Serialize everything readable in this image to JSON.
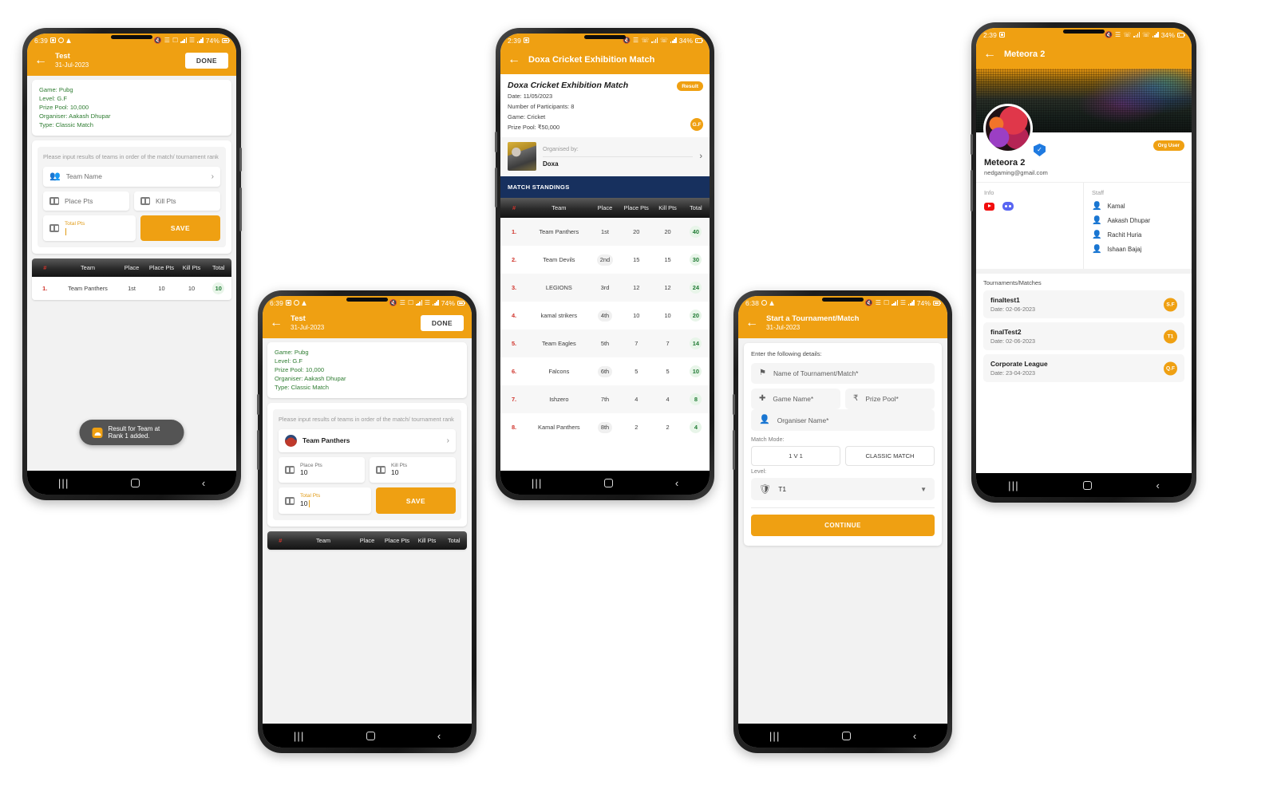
{
  "colors": {
    "accent": "#efa012",
    "green_text": "#2f7d32",
    "navy": "#17305e",
    "verify_blue": "#1f7ae0"
  },
  "phone1": {
    "status": {
      "time": "6:39",
      "battery": "74%"
    },
    "appbar": {
      "title": "Test",
      "subtitle": "31-Jul-2023",
      "done_label": "DONE"
    },
    "info": {
      "game": "Game: Pubg",
      "level": "Level: G.F",
      "prize": "Prize Pool: 10,000",
      "organiser": "Organiser: Aakash Dhupar",
      "type": "Type: Classic Match"
    },
    "hint": "Please input results of teams in order of the match/ tournament rank",
    "team_field_placeholder": "Team Name",
    "place_pts_placeholder": "Place Pts",
    "kill_pts_placeholder": "Kill Pts",
    "total_pts_label": "Total Pts",
    "total_pts_value": "",
    "save_label": "SAVE",
    "table": {
      "headers": [
        "#",
        "Team",
        "Place",
        "Place Pts",
        "Kill Pts",
        "Total"
      ],
      "rows": [
        {
          "num": "1.",
          "team": "Team Panthers",
          "place": "1st",
          "place_pts": "10",
          "kill_pts": "10",
          "total": "10"
        }
      ]
    },
    "toast": "Result for Team at Rank 1 added."
  },
  "phone2": {
    "status": {
      "time": "6:39",
      "battery": "74%"
    },
    "appbar": {
      "title": "Test",
      "subtitle": "31-Jul-2023",
      "done_label": "DONE"
    },
    "info": {
      "game": "Game: Pubg",
      "level": "Level: G.F",
      "prize": "Prize Pool: 10,000",
      "organiser": "Organiser: Aakash Dhupar",
      "type": "Type: Classic Match"
    },
    "hint": "Please input results of teams in order of the match/ tournament rank",
    "selected_team": "Team Panthers",
    "place_pts_label": "Place Pts",
    "place_pts_value": "10",
    "kill_pts_label": "Kill Pts",
    "kill_pts_value": "10",
    "total_pts_label": "Total Pts",
    "total_pts_value": "10",
    "save_label": "SAVE",
    "table": {
      "headers": [
        "#",
        "Team",
        "Place",
        "Place Pts",
        "Kill Pts",
        "Total"
      ],
      "rows": []
    }
  },
  "phone3": {
    "status": {
      "time": "2:39",
      "battery": "34%"
    },
    "appbar": {
      "title": "Doxa Cricket Exhibition Match"
    },
    "detail": {
      "title": "Doxa Cricket Exhibition Match",
      "date": "Date: 11/05/2023",
      "participants": "Number of Participants: 8",
      "game": "Game: Cricket",
      "prize": "Prize Pool: ₹50,000",
      "result_badge": "Result",
      "level_badge": "G.F",
      "organised_by_label": "Organised by:",
      "organiser_name": "Doxa"
    },
    "standings_label": "MATCH STANDINGS",
    "table": {
      "headers": [
        "#",
        "Team",
        "Place",
        "Place Pts",
        "Kill Pts",
        "Total"
      ],
      "rows": [
        {
          "num": "1.",
          "team": "Team Panthers",
          "place": "1st",
          "place_pts": "20",
          "kill_pts": "20",
          "total": "40"
        },
        {
          "num": "2.",
          "team": "Team Devils",
          "place": "2nd",
          "place_pts": "15",
          "kill_pts": "15",
          "total": "30"
        },
        {
          "num": "3.",
          "team": "LEGIONS",
          "place": "3rd",
          "place_pts": "12",
          "kill_pts": "12",
          "total": "24"
        },
        {
          "num": "4.",
          "team": "kamal strikers",
          "place": "4th",
          "place_pts": "10",
          "kill_pts": "10",
          "total": "20"
        },
        {
          "num": "5.",
          "team": "Team Eagles",
          "place": "5th",
          "place_pts": "7",
          "kill_pts": "7",
          "total": "14"
        },
        {
          "num": "6.",
          "team": "Falcons",
          "place": "6th",
          "place_pts": "5",
          "kill_pts": "5",
          "total": "10"
        },
        {
          "num": "7.",
          "team": "Ishzero",
          "place": "7th",
          "place_pts": "4",
          "kill_pts": "4",
          "total": "8"
        },
        {
          "num": "8.",
          "team": "Kamal Panthers",
          "place": "8th",
          "place_pts": "2",
          "kill_pts": "2",
          "total": "4"
        }
      ]
    }
  },
  "phone4": {
    "status": {
      "time": "6:38",
      "battery": "74%"
    },
    "appbar": {
      "title": "Start a Tournament/Match",
      "subtitle": "31-Jul-2023"
    },
    "form": {
      "intro": "Enter the following details:",
      "name_placeholder": "Name of Tournament/Match*",
      "game_placeholder": "Game Name*",
      "prize_placeholder": "Prize Pool*",
      "organiser_placeholder": "Organiser Name*",
      "match_mode_label": "Match Mode:",
      "mode_options": [
        "1 V 1",
        "CLASSIC MATCH"
      ],
      "level_label": "Level:",
      "level_value": "T1",
      "continue_label": "CONTINUE"
    }
  },
  "phone5": {
    "status": {
      "time": "2:39",
      "battery": "34%"
    },
    "appbar": {
      "title": "Meteora 2"
    },
    "profile": {
      "name": "Meteora 2",
      "email": "nedgaming@gmail.com",
      "org_badge": "Org User",
      "info_label": "Info",
      "socials": [
        "youtube-icon",
        "discord-icon"
      ],
      "staff_label": "Staff",
      "staff": [
        "Kamal",
        "Aakash Dhupar",
        "Rachit Huria",
        "Ishaan Bajaj"
      ],
      "tournaments_label": "Tournaments/Matches",
      "tournaments": [
        {
          "name": "finaltest1",
          "date": "Date: 02-06-2023",
          "badge": "S.F"
        },
        {
          "name": "finalTest2",
          "date": "Date: 02-06-2023",
          "badge": "T1"
        },
        {
          "name": "Corporate League",
          "date": "Date: 23-04-2023",
          "badge": "Q.F"
        }
      ]
    }
  }
}
